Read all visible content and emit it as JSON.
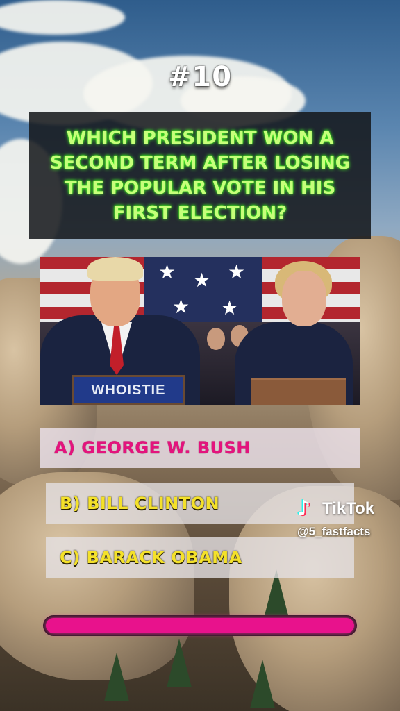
{
  "quiz": {
    "number": "#10",
    "question": "WHICH PRESIDENT WON A SECOND TERM AFTER LOSING THE POPULAR VOTE IN HIS FIRST ELECTION?",
    "image": {
      "podium_text": "WHOISTIE"
    },
    "answers": [
      {
        "label": "A) GEORGE W. BUSH",
        "color": "#e4137d"
      },
      {
        "label": "B) BILL CLINTON",
        "color": "#f4e12a"
      },
      {
        "label": "C) BARACK OBAMA",
        "color": "#f4e12a"
      }
    ],
    "timer_progress": 1.0
  },
  "watermark": {
    "brand": "TikTok",
    "handle": "@5_fastfacts",
    "icon": "tiktok-note-icon"
  },
  "colors": {
    "question_text": "#c6ff7a",
    "progress_fill": "#e8128c"
  }
}
